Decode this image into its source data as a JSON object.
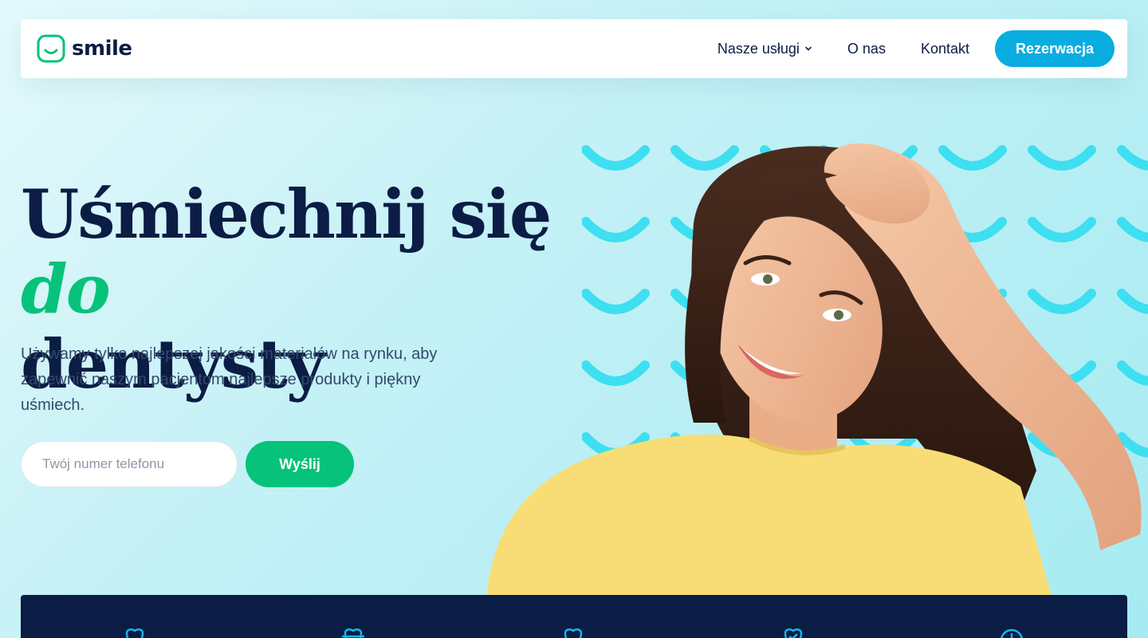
{
  "brand": {
    "name": "smile",
    "logo_icon": "smile-face-icon",
    "accent": "#06c27a"
  },
  "nav": {
    "links": [
      {
        "label": "Nasze usługi",
        "has_dropdown": true
      },
      {
        "label": "O nas"
      },
      {
        "label": "Kontakt"
      }
    ],
    "cta_label": "Rezerwacja",
    "cta_color": "#09ade0"
  },
  "hero": {
    "title_part1": "Uśmiechnij się",
    "title_accent": "do",
    "title_part2": "dentysty",
    "subtitle": "Używamy tylko najlepszej jakości materiałów na rynku, aby zapewnić naszym pacjentom najlepsze produkty i piękny uśmiech.",
    "phone_placeholder": "Twój numer telefonu",
    "phone_value": "",
    "submit_label": "Wyślij",
    "submit_color": "#06c27a"
  },
  "features": {
    "icons": [
      "tooth-icon",
      "tooth-brace-icon",
      "tooth-icon",
      "tooth-check-icon",
      "clock-icon"
    ],
    "background": "#0b1c45"
  }
}
